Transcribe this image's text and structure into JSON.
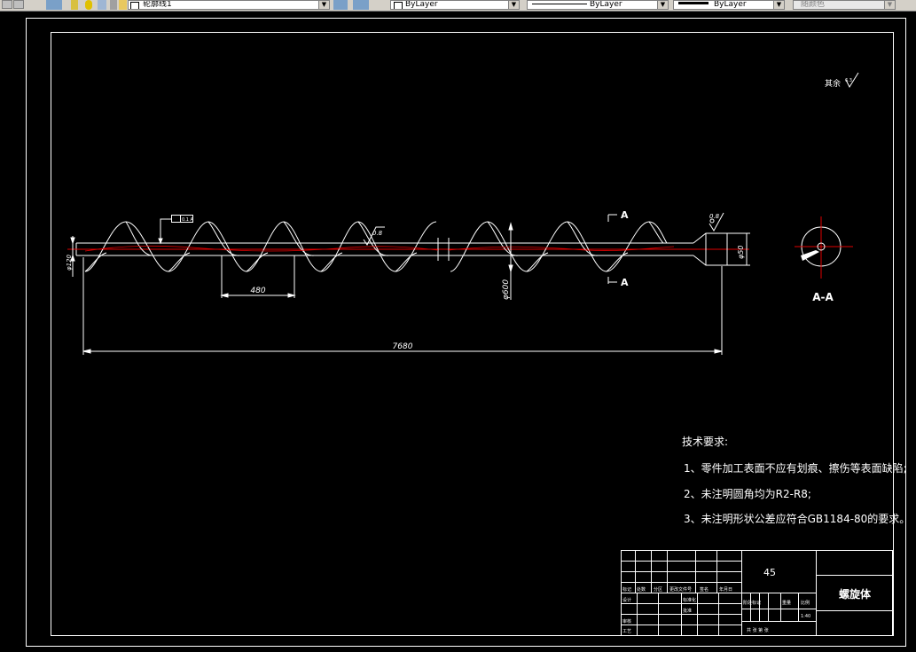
{
  "toolbar": {
    "layer_name": "轮廓线1",
    "color_value": "ByLayer",
    "linetype_value": "ByLayer",
    "lineweight_value": "ByLayer",
    "plotstyle_value": "随颜色"
  },
  "drawing": {
    "surface_finish_note": "其余",
    "surface_finish_value": "6.3",
    "dim_total_length": "7680",
    "dim_pitch": "480",
    "dim_shaft_diameter": "φ120",
    "dim_blade_diameter": "φ600",
    "dim_end_diameter": "φ50",
    "roughness_blade": "0.8",
    "roughness_end": "0.8",
    "tolerance_frame": "0.1 A",
    "section_marker": "A",
    "section_title": "A-A",
    "tech_req_title": "技术要求:",
    "tech_req_1": "1、零件加工表面不应有划痕、擦伤等表面缺陷;",
    "tech_req_2": "2、未注明圆角均为R2-R8;",
    "tech_req_3": "3、未注明形状公差应符合GB1184-80的要求。"
  },
  "title_block": {
    "material": "45",
    "part_name": "螺旋体",
    "row_labels": [
      "标记",
      "处数",
      "分区",
      "更改文件号",
      "签名",
      "年月日"
    ],
    "design": "设计",
    "standardize": "标准化",
    "review": "审核",
    "process": "工艺",
    "approve": "批准",
    "stage_mark": "阶段标记",
    "weight": "重量",
    "scale": "比例",
    "scale_value": "1:40",
    "sheets": "共 张 第 张"
  }
}
